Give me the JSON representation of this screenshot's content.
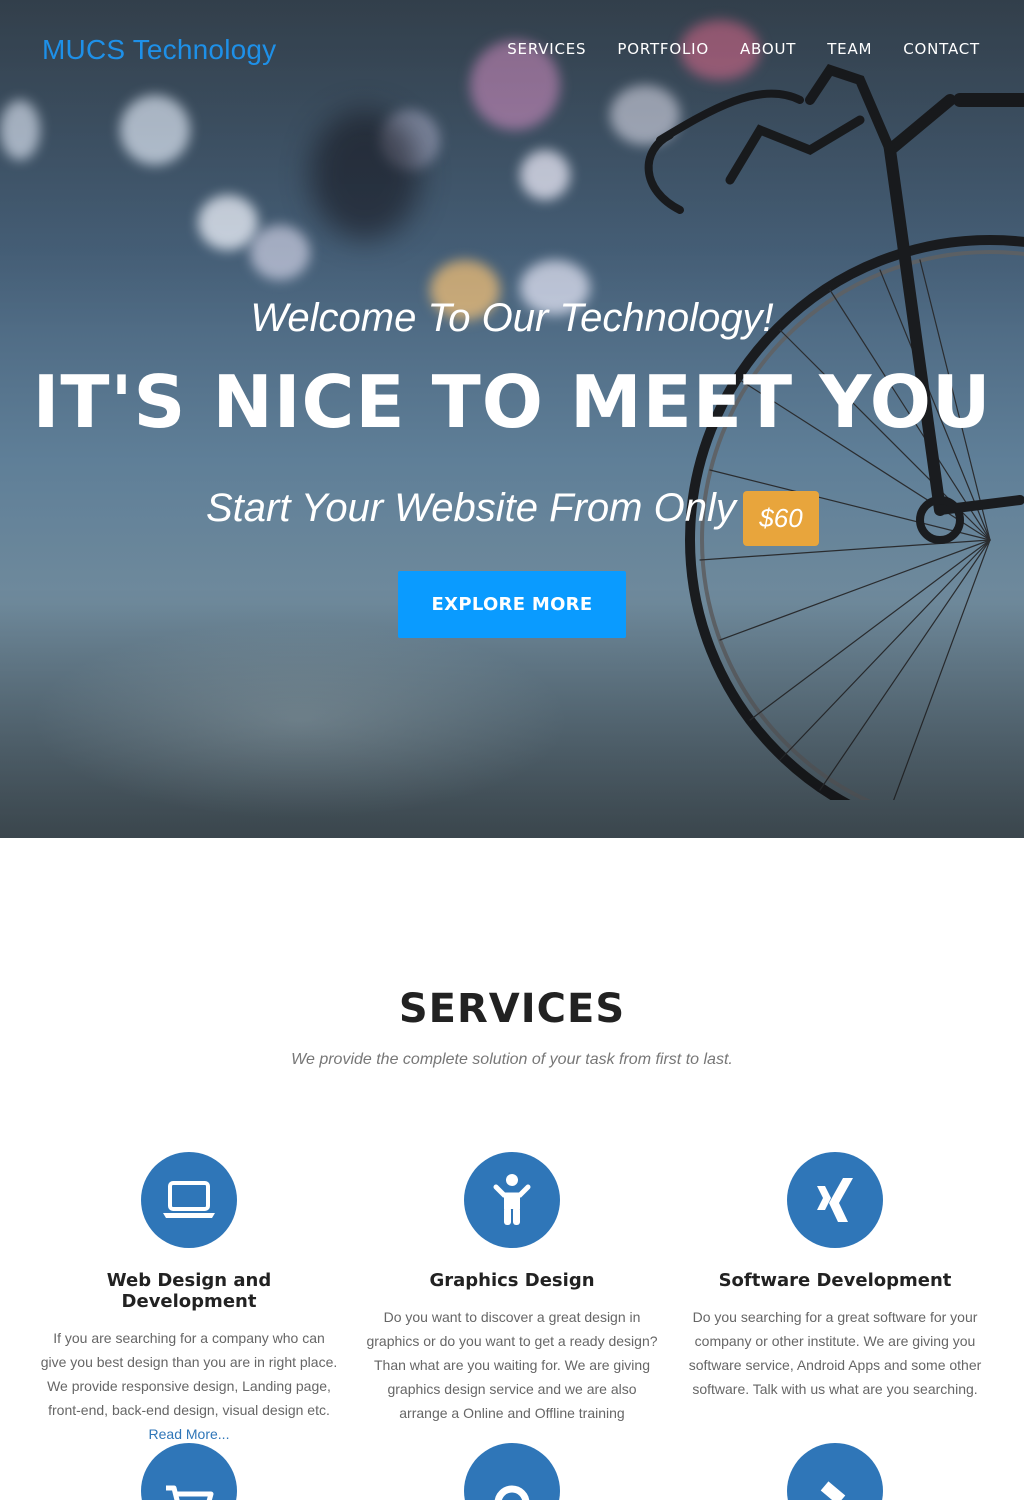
{
  "brand": "MUCS Technology",
  "nav": [
    "SERVICES",
    "PORTFOLIO",
    "ABOUT",
    "TEAM",
    "CONTACT"
  ],
  "hero": {
    "welcome": "Welcome To Our Technology!",
    "headline": "IT'S NICE TO MEET YOU",
    "start_text": "Start Your Website From Only",
    "price": "$60",
    "cta": "EXPLORE MORE"
  },
  "services": {
    "title": "SERVICES",
    "subtitle": "We provide the complete solution of your task from first to last.",
    "items": [
      {
        "icon": "laptop-icon",
        "title": "Web Design and Development",
        "text": "If you are searching for a company who can give you best design than you are in right place. We provide responsive design, Landing page, front-end, back-end design, visual design etc.",
        "link": "Read More..."
      },
      {
        "icon": "child-icon",
        "title": "Graphics Design",
        "text": "Do you want to discover a great design in graphics or do you want to get a ready design? Than what are you waiting for. We are giving graphics design service and we are also arrange a Online and Offline training"
      },
      {
        "icon": "xing-icon",
        "title": "Software Development",
        "text": "Do you searching for a great software for your company or other institute. We are giving you software service, Android Apps and some other software. Talk with us what are you searching."
      }
    ],
    "lower_icons": [
      "cart-icon",
      "map-marker-icon",
      "gavel-icon"
    ]
  },
  "colors": {
    "accent": "#0a9bff",
    "brand": "#1e90e8",
    "price_badge": "#e8a53c",
    "icon_circle": "#2f76b8"
  }
}
